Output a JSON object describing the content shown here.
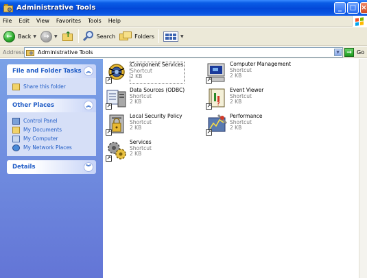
{
  "window": {
    "title": "Administrative Tools"
  },
  "menu": [
    "File",
    "Edit",
    "View",
    "Favorites",
    "Tools",
    "Help"
  ],
  "toolbar": {
    "back": "Back",
    "search": "Search",
    "folders": "Folders"
  },
  "address": {
    "label": "Address",
    "value": "Administrative Tools",
    "go": "Go"
  },
  "tasks": {
    "file_folder": {
      "title": "File and Folder Tasks",
      "links": [
        "Share this folder"
      ]
    },
    "other_places": {
      "title": "Other Places",
      "links": [
        "Control Panel",
        "My Documents",
        "My Computer",
        "My Network Places"
      ]
    },
    "details": {
      "title": "Details"
    }
  },
  "items": [
    {
      "name": "Component Services",
      "type": "Shortcut",
      "size": "2 KB",
      "icon": "component-services-icon",
      "selected": true
    },
    {
      "name": "Computer Management",
      "type": "Shortcut",
      "size": "2 KB",
      "icon": "computer-management-icon"
    },
    {
      "name": "Data Sources (ODBC)",
      "type": "Shortcut",
      "size": "2 KB",
      "icon": "data-sources-icon"
    },
    {
      "name": "Event Viewer",
      "type": "Shortcut",
      "size": "2 KB",
      "icon": "event-viewer-icon"
    },
    {
      "name": "Local Security Policy",
      "type": "Shortcut",
      "size": "2 KB",
      "icon": "local-security-policy-icon"
    },
    {
      "name": "Performance",
      "type": "Shortcut",
      "size": "2 KB",
      "icon": "performance-icon"
    },
    {
      "name": "Services",
      "type": "Shortcut",
      "size": "2 KB",
      "icon": "services-icon"
    }
  ],
  "colors": {
    "title_bar": "#0a5ce6",
    "task_pane": "#6f8fe0",
    "link": "#215dc6"
  }
}
